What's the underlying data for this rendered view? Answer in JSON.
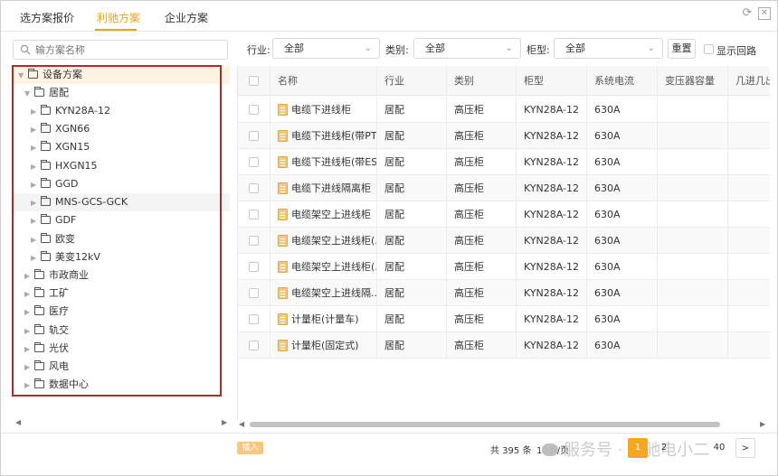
{
  "tabs": [
    {
      "label": "选方案报价"
    },
    {
      "label": "利驰方案"
    },
    {
      "label": "企业方案"
    }
  ],
  "search": {
    "placeholder": "输方案名称"
  },
  "tree": {
    "root": "设备方案",
    "items": [
      {
        "label": "居配"
      },
      {
        "label": "KYN28A-12"
      },
      {
        "label": "XGN66"
      },
      {
        "label": "XGN15"
      },
      {
        "label": "HXGN15"
      },
      {
        "label": "GGD"
      },
      {
        "label": "MNS-GCS-GCK"
      },
      {
        "label": "GDF"
      },
      {
        "label": "欧变"
      },
      {
        "label": "美变12kV"
      },
      {
        "label": "市政商业"
      },
      {
        "label": "工矿"
      },
      {
        "label": "医疗"
      },
      {
        "label": "轨交"
      },
      {
        "label": "光伏"
      },
      {
        "label": "风电"
      },
      {
        "label": "数据中心"
      }
    ]
  },
  "filters": {
    "industry_label": "行业:",
    "industry_value": "全部",
    "category_label": "类别:",
    "category_value": "全部",
    "cabinet_label": "柜型:",
    "cabinet_value": "全部",
    "reset_label": "重置",
    "show_loop_label": "显示回路"
  },
  "table": {
    "columns": [
      "名称",
      "行业",
      "类别",
      "柜型",
      "系统电流",
      "变压器容量",
      "几进几出"
    ],
    "rows": [
      {
        "name": "电缆下进线柜",
        "industry": "居配",
        "category": "高压柜",
        "cabinet": "KYN28A-12",
        "current": "630A"
      },
      {
        "name": "电缆下进线柜(带PT...",
        "industry": "居配",
        "category": "高压柜",
        "cabinet": "KYN28A-12",
        "current": "630A"
      },
      {
        "name": "电缆下进线柜(带ES)",
        "industry": "居配",
        "category": "高压柜",
        "cabinet": "KYN28A-12",
        "current": "630A"
      },
      {
        "name": "电缆下进线隔离柜",
        "industry": "居配",
        "category": "高压柜",
        "cabinet": "KYN28A-12",
        "current": "630A"
      },
      {
        "name": "电缆架空上进线柜",
        "industry": "居配",
        "category": "高压柜",
        "cabinet": "KYN28A-12",
        "current": "630A"
      },
      {
        "name": "电缆架空上进线柜(...",
        "industry": "居配",
        "category": "高压柜",
        "cabinet": "KYN28A-12",
        "current": "630A"
      },
      {
        "name": "电缆架空上进线柜(...",
        "industry": "居配",
        "category": "高压柜",
        "cabinet": "KYN28A-12",
        "current": "630A"
      },
      {
        "name": "电缆架空上进线隔...",
        "industry": "居配",
        "category": "高压柜",
        "cabinet": "KYN28A-12",
        "current": "630A"
      },
      {
        "name": "计量柜(计量车)",
        "industry": "居配",
        "category": "高压柜",
        "cabinet": "KYN28A-12",
        "current": "630A"
      },
      {
        "name": "计量柜(固定式)",
        "industry": "居配",
        "category": "高压柜",
        "cabinet": "KYN28A-12",
        "current": "630A"
      }
    ]
  },
  "footer": {
    "import_label": "插入",
    "total": "共 395 条",
    "page_size": "10条/页",
    "pages": [
      "1",
      "2",
      "40"
    ],
    "active_page": "1",
    "next": ">"
  },
  "watermark": "服务号 · 利驰电小二",
  "colors": {
    "accent": "#f0a020",
    "highlight_box": "#b02a28"
  }
}
